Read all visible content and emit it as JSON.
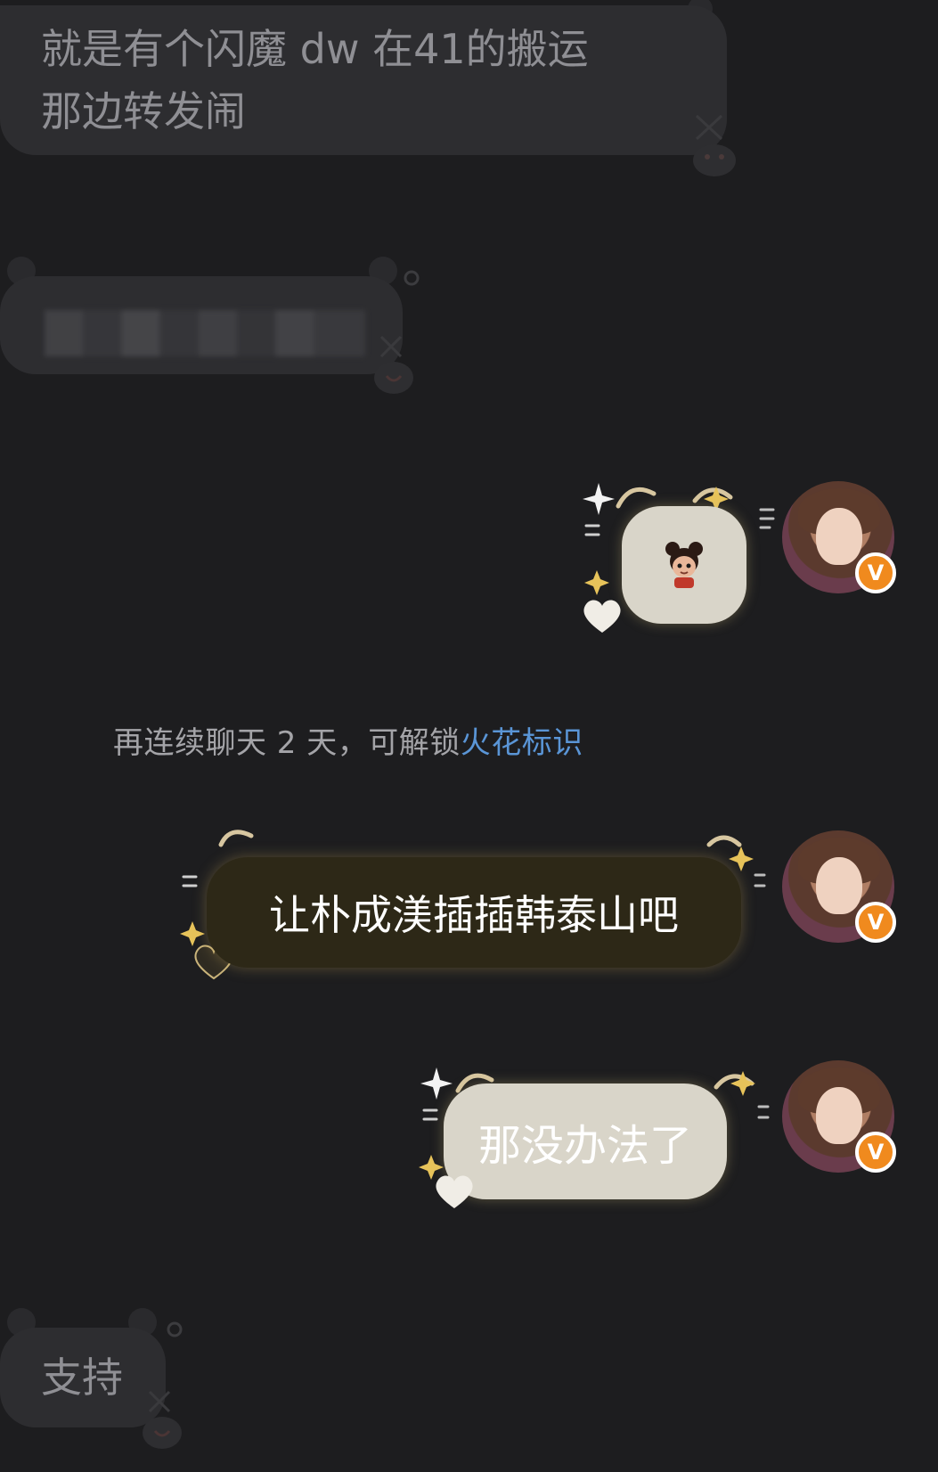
{
  "messages": [
    {
      "side": "incoming",
      "text": "就是有个闪魔 dw 在41的搬运\n那边转发闹"
    },
    {
      "side": "incoming",
      "text": "",
      "redacted": true
    },
    {
      "side": "outgoing",
      "type": "sticker",
      "sticker_icon": "cartoon-girl-sticker-icon"
    },
    {
      "side": "outgoing",
      "text": "让朴成渼插插韩泰山吧"
    },
    {
      "side": "outgoing",
      "text": "那没办法了"
    },
    {
      "side": "incoming",
      "text": "支持"
    }
  ],
  "system_notice": {
    "text": "再连续聊天 2 天，可解锁",
    "link": "火花标识"
  },
  "avatar": {
    "badge": "V",
    "badge_color": "#f08a1e"
  },
  "colors": {
    "background": "#1d1d1f",
    "incoming_bubble": "#2d2d30",
    "outgoing_light_bubble": "#d9d5c9",
    "outgoing_dark_bubble": "#2d2817",
    "link": "#5a95d6",
    "sparkle": "#e7c35a"
  }
}
